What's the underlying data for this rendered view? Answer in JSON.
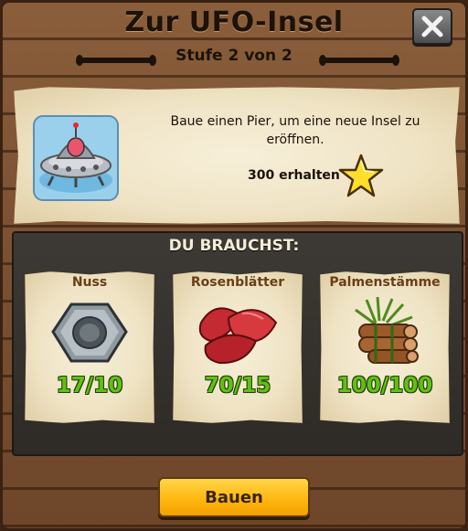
{
  "dialog": {
    "title": "Zur UFO-Insel",
    "stage": "Stufe 2 von 2"
  },
  "quest": {
    "description": "Baue einen Pier, um eine neue Insel zu eröffnen.",
    "reward_text": "300 erhalten",
    "reward_icon": "star-icon",
    "image_icon": "ufo-icon"
  },
  "requirements": {
    "heading": "DU BRAUCHST:",
    "items": [
      {
        "label": "Nuss",
        "count": "17/10",
        "icon": "nut-icon"
      },
      {
        "label": "Rosenblätter",
        "count": "70/15",
        "icon": "rose-petals-icon"
      },
      {
        "label": "Palmenstämme",
        "count": "100/100",
        "icon": "palm-logs-icon"
      }
    ]
  },
  "actions": {
    "build_label": "Bauen",
    "close_icon": "close-icon"
  },
  "colors": {
    "count_green": "#5fc112",
    "button_yellow": "#ffb80f",
    "label_brown": "#6a3e17"
  }
}
